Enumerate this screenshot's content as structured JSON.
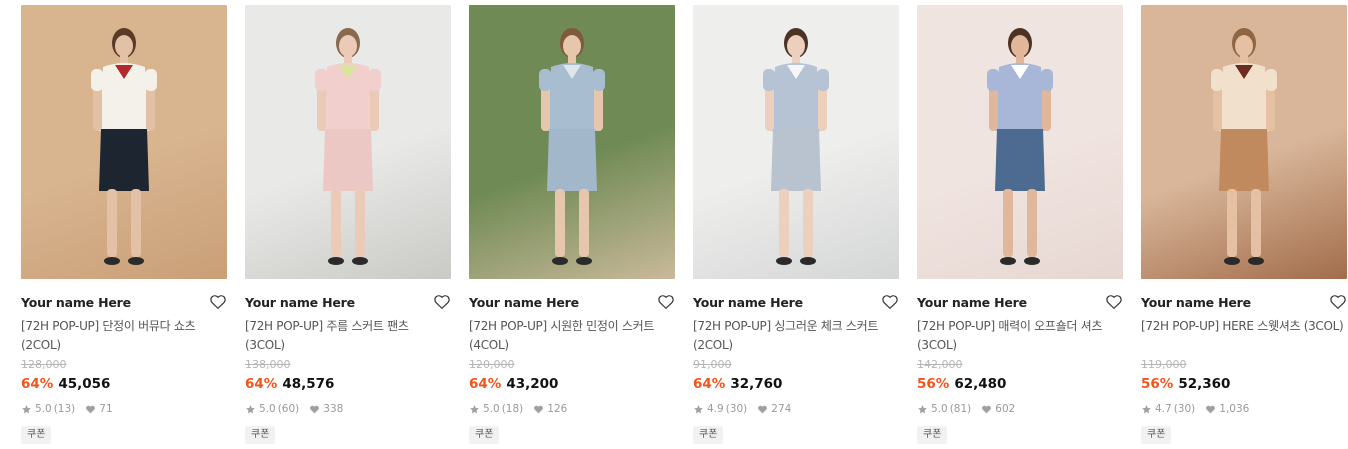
{
  "products": [
    {
      "brand": "Your name Here",
      "title": "[72H POP-UP] 단정이 버뮤다 쇼츠 (2COL)",
      "original_price": "128,000",
      "discount": "64%",
      "price": "45,056",
      "rating": "5.0",
      "reviews": "(13)",
      "likes": "71",
      "coupon": "쿠폰",
      "image": {
        "bg": "#d8b48f",
        "bg2": "#c99f77",
        "top": "#f3f1ea",
        "accent": "#b3282d",
        "bottom": "#1d2530",
        "skin": "#e3c1a6",
        "hair": "#5a3b28"
      }
    },
    {
      "brand": "Your name Here",
      "title": "[72H POP-UP] 주름 스커트 팬츠 (3COL)",
      "original_price": "138,000",
      "discount": "64%",
      "price": "48,576",
      "rating": "5.0",
      "reviews": "(60)",
      "likes": "338",
      "coupon": "쿠폰",
      "image": {
        "bg": "#e9e9e7",
        "bg2": "#c9c9c6",
        "top": "#f0cfcc",
        "accent": "#d8e59a",
        "bottom": "#ecc8c4",
        "skin": "#ebcbb7",
        "hair": "#8a6a4f"
      }
    },
    {
      "brand": "Your name Here",
      "title": "[72H POP-UP] 시원한 민정이 스커트 (4COL)",
      "original_price": "120,000",
      "discount": "64%",
      "price": "43,200",
      "rating": "5.0",
      "reviews": "(18)",
      "likes": "126",
      "coupon": "쿠폰",
      "image": {
        "bg": "#6f8a54",
        "bg2": "#c9b99a",
        "top": "#a9bdd0",
        "accent": "#dfe6ea",
        "bottom": "#a3b7cb",
        "skin": "#e6c7ae",
        "hair": "#7d5a3c"
      }
    },
    {
      "brand": "Your name Here",
      "title": "[72H POP-UP] 싱그러운 체크 스커트 (2COL)",
      "original_price": "91,000",
      "discount": "64%",
      "price": "32,760",
      "rating": "4.9",
      "reviews": "(30)",
      "likes": "274",
      "coupon": "쿠폰",
      "image": {
        "bg": "#eeeeec",
        "bg2": "#d4d6d6",
        "top": "#b6c3d4",
        "accent": "#f7f7f7",
        "bottom": "#b9c2cf",
        "skin": "#ecd0bd",
        "hair": "#4a3325"
      }
    },
    {
      "brand": "Your name Here",
      "title": "[72H POP-UP] 매력이 오프숄더 셔츠 (3COL)",
      "original_price": "142,000",
      "discount": "56%",
      "price": "62,480",
      "rating": "5.0",
      "reviews": "(81)",
      "likes": "602",
      "coupon": "쿠폰",
      "image": {
        "bg": "#f0e4e0",
        "bg2": "#e7d7d2",
        "top": "#a8b6d8",
        "accent": "#ffffff",
        "bottom": "#4d6b91",
        "skin": "#e0b79a",
        "hair": "#4b3223"
      }
    },
    {
      "brand": "Your name Here",
      "title": "[72H POP-UP] HERE 스웻셔츠 (3COL)",
      "original_price": "119,000",
      "discount": "56%",
      "price": "52,360",
      "rating": "4.7",
      "reviews": "(30)",
      "likes": "1,036",
      "coupon": "쿠폰",
      "image": {
        "bg": "#d9b69a",
        "bg2": "#a26d4b",
        "top": "#f1e0cc",
        "accent": "#6e2a22",
        "bottom": "#c08a5e",
        "skin": "#e6c0a2",
        "hair": "#8f6542"
      }
    }
  ],
  "colors": {
    "discount": "#f0551e",
    "muted": "#9a9a9a",
    "strike": "#b5b5b5"
  }
}
